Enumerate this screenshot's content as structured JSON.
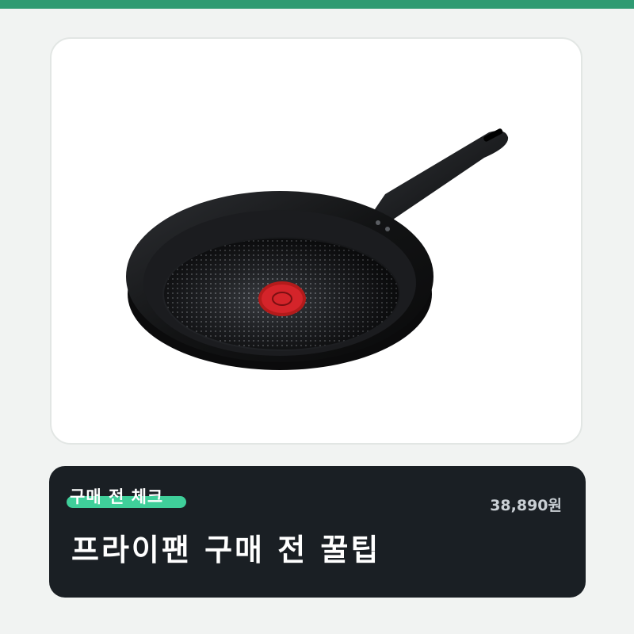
{
  "card": {
    "tag": "구매 전 체크",
    "price": "38,890원",
    "headline": "프라이팬 구매 전 꿀팁"
  },
  "colors": {
    "accent": "#2f9b72",
    "highlight": "#3fcf9a",
    "card_bg": "#1a1f24",
    "page_bg": "#f1f3f2"
  },
  "image": {
    "subject": "frying-pan"
  }
}
